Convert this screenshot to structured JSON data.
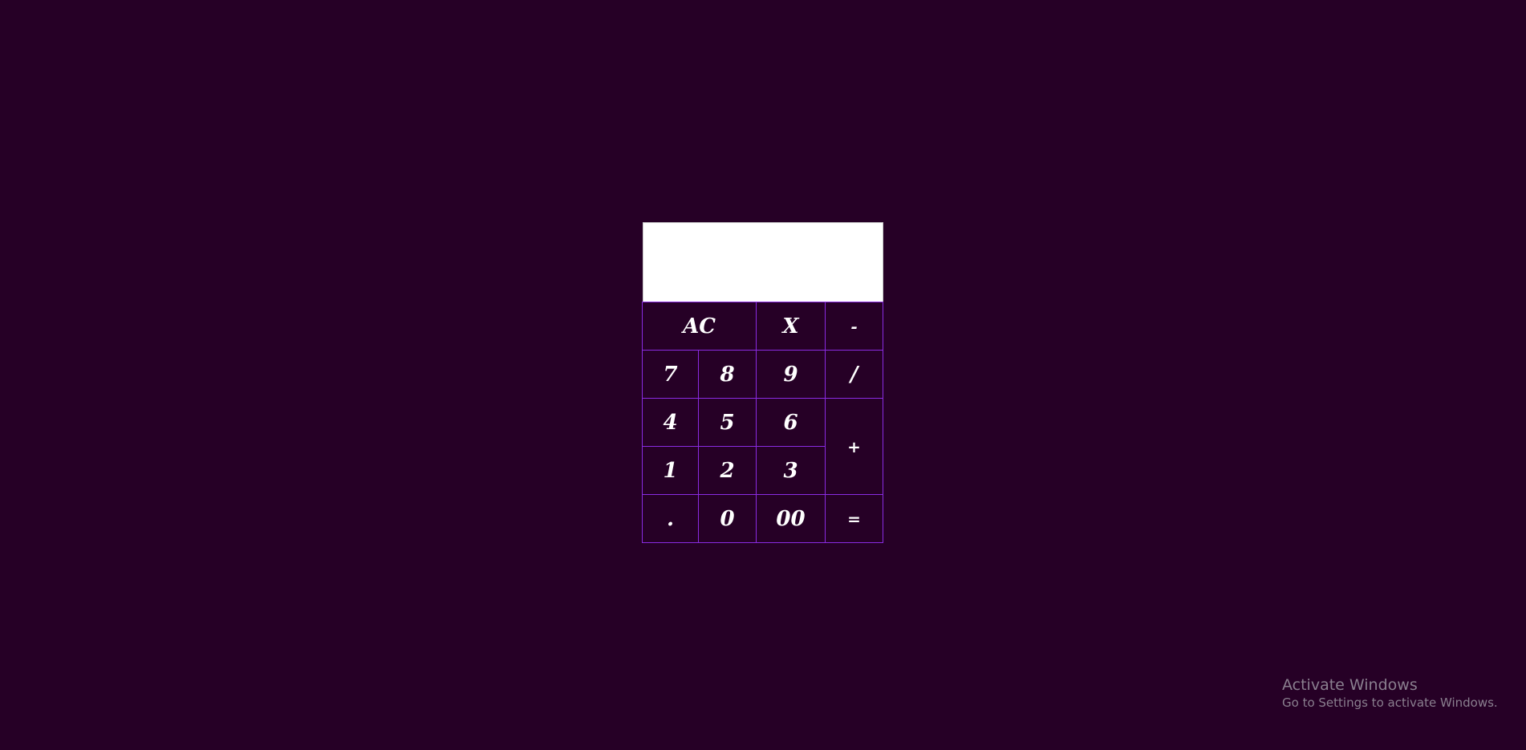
{
  "colors": {
    "background": "#260026",
    "display": "#ffffff",
    "key_border": "#8a2be2",
    "key_text": "#ffffff"
  },
  "calculator": {
    "display_value": "",
    "keys": {
      "ac": "AC",
      "x": "X",
      "minus": "-",
      "seven": "7",
      "eight": "8",
      "nine": "9",
      "divide": "/",
      "four": "4",
      "five": "5",
      "six": "6",
      "plus": "+",
      "one": "1",
      "two": "2",
      "three": "3",
      "dot": ".",
      "zero": "0",
      "double_zero": "00",
      "equals": "="
    }
  },
  "watermark": {
    "title": "Activate Windows",
    "subtitle": "Go to Settings to activate Windows."
  }
}
